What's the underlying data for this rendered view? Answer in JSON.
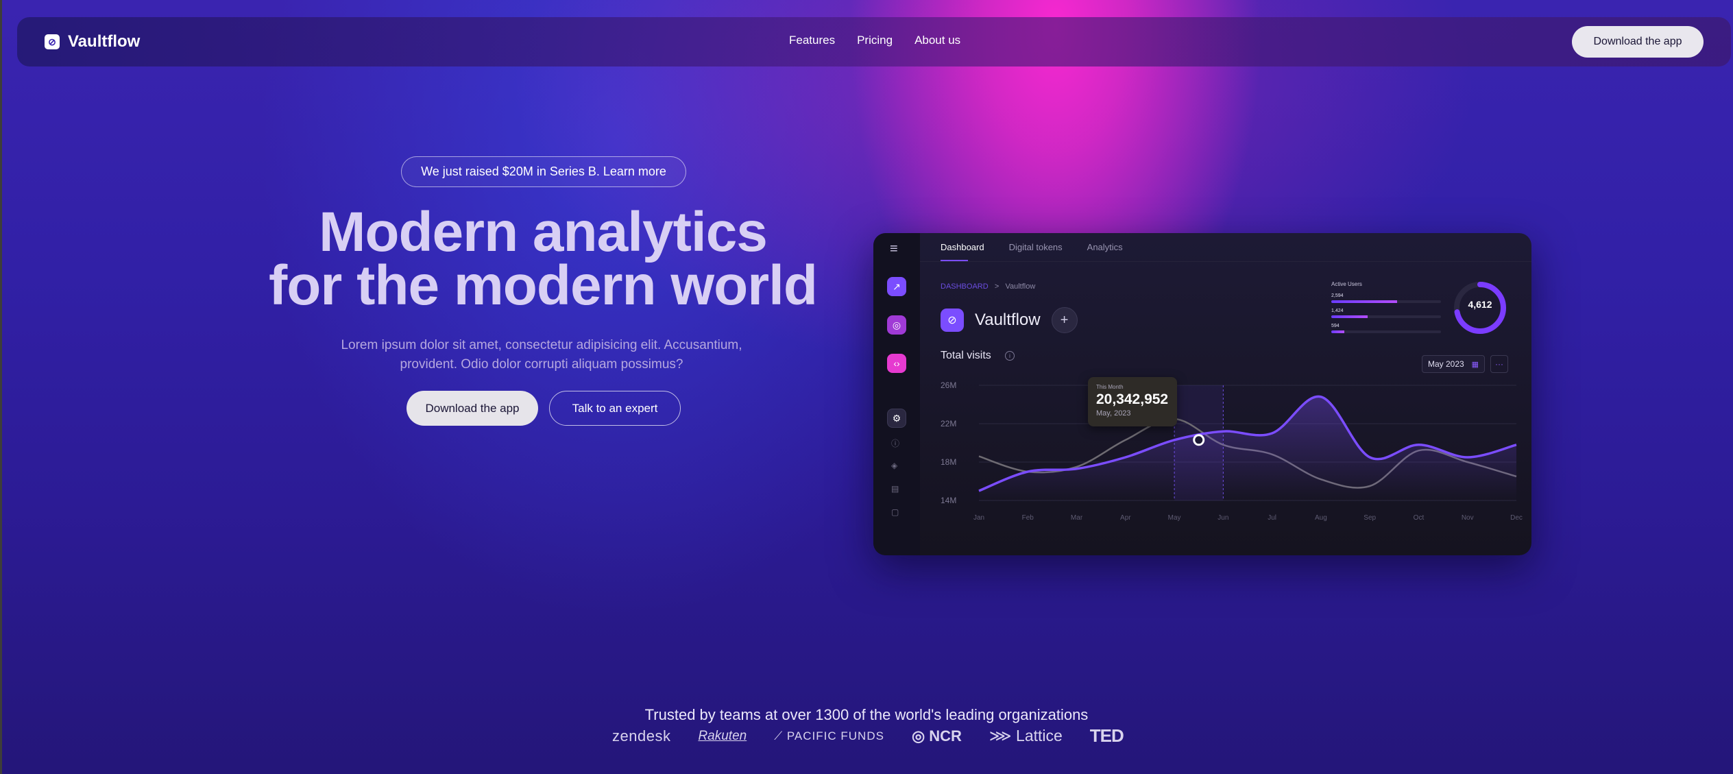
{
  "nav": {
    "brand": "Vaultflow",
    "links": [
      "Features",
      "Pricing",
      "About us"
    ],
    "cta": "Download the app"
  },
  "hero": {
    "announcement": "We just raised $20M in Series B. Learn more",
    "headline_line1": "Modern analytics",
    "headline_line2": "for the modern world",
    "subtext_line1": "Lorem ipsum dolor sit amet, consectetur adipisicing elit. Accusantium,",
    "subtext_line2": "provident. Odio dolor corrupti aliquam possimus?",
    "primary_button": "Download the app",
    "secondary_button": "Talk to an expert"
  },
  "dashboard": {
    "tabs": [
      "Dashboard",
      "Digital tokens",
      "Analytics"
    ],
    "breadcrumb_root": "DASHBOARD",
    "breadcrumb_sep": ">",
    "breadcrumb_current": "Vaultflow",
    "workspace_title": "Vaultflow",
    "add_label": "+",
    "chart_title": "Total visits",
    "info_glyph": "i",
    "date_filter": "May 2023",
    "more_glyph": "···",
    "active_users": {
      "title": "Active Users",
      "rows": [
        {
          "value": "2,594",
          "fill": 0.6
        },
        {
          "value": "1,424",
          "fill": 0.33
        },
        {
          "value": "594",
          "fill": 0.12
        }
      ],
      "total": "4,612",
      "ring_fill": 0.72
    },
    "tooltip": {
      "label": "This Month",
      "value": "20,342,952",
      "date": "May, 2023"
    },
    "colors": {
      "accent": "#7b4dff",
      "magenta": "#e63ad0",
      "ghost": "#6e6b72"
    }
  },
  "chart_data": {
    "type": "line",
    "categories": [
      "Jan",
      "Feb",
      "Mar",
      "Apr",
      "May",
      "Jun",
      "Jul",
      "Aug",
      "Sep",
      "Oct",
      "Nov",
      "Dec"
    ],
    "y_ticks": [
      "26M",
      "22M",
      "18M",
      "14M"
    ],
    "ylim": [
      14,
      26
    ],
    "series": [
      {
        "values": [
          15,
          17,
          17.3,
          18.5,
          20.3,
          21.2,
          21,
          24.8,
          18.5,
          19.8,
          18.5,
          19.8
        ]
      },
      {
        "values": [
          18.6,
          17,
          17.5,
          20.3,
          22.5,
          19.8,
          18.8,
          16.2,
          15.5,
          19.2,
          18,
          16.5
        ]
      }
    ],
    "highlight_index": 4,
    "highlight_value": 20.3
  },
  "trusted": {
    "caption": "Trusted by teams at over 1300 of the world's leading organizations",
    "logos": [
      "zendesk",
      "Rakuten",
      "PACIFIC FUNDS",
      "NCR",
      "Lattice",
      "TED"
    ]
  }
}
